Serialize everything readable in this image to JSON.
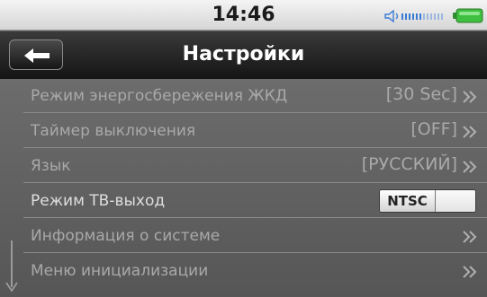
{
  "status": {
    "time": "14:46",
    "volume_icon": "speaker-volume-icon",
    "battery_icon": "battery-icon",
    "accent_color": "#3a7bd5",
    "battery_color": "#3fbf3f"
  },
  "header": {
    "title": "Настройки",
    "back_icon": "arrow-left-icon"
  },
  "settings": {
    "items": [
      {
        "label": "Режим энергосбережения ЖКД",
        "value": "[30 Sec]"
      },
      {
        "label": "Таймер выключения",
        "value": "[OFF]"
      },
      {
        "label": "Язык",
        "value": "[РУССКИЙ]"
      },
      {
        "label": "Режим ТВ-выход",
        "toggle": "NTSC"
      },
      {
        "label": "Информация о системе"
      },
      {
        "label": "Меню инициализации"
      }
    ]
  }
}
